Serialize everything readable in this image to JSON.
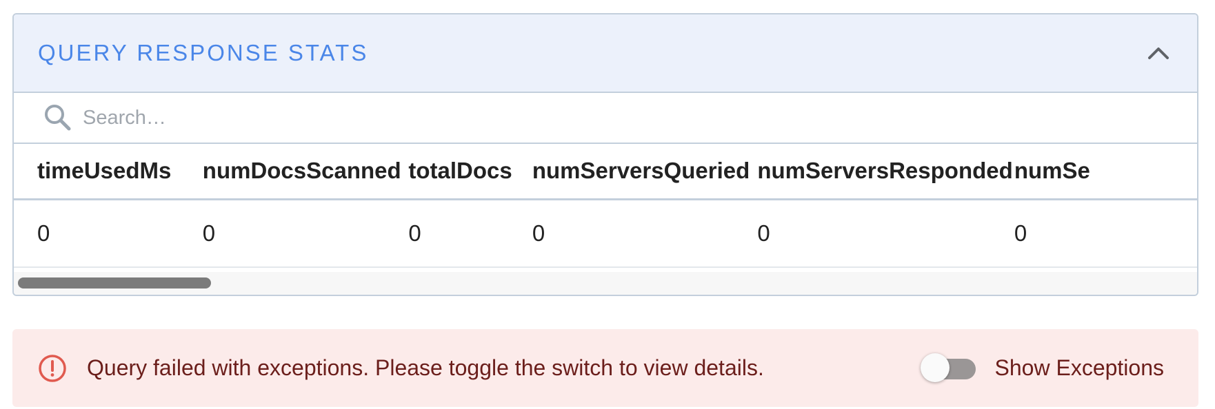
{
  "stats_panel": {
    "title": "QUERY RESPONSE STATS",
    "collapse_icon": "chevron-up-icon",
    "search": {
      "placeholder": "Search…",
      "value": "",
      "icon": "search-icon"
    },
    "table": {
      "columns": [
        "timeUsedMs",
        "numDocsScanned",
        "totalDocs",
        "numServersQueried",
        "numServersResponded",
        "numSe"
      ],
      "rows": [
        [
          "0",
          "0",
          "0",
          "0",
          "0",
          "0"
        ]
      ]
    }
  },
  "error_banner": {
    "icon": "error-circle-icon",
    "message": "Query failed with exceptions. Please toggle the switch to view details.",
    "toggle_label": "Show Exceptions",
    "toggle_on": false
  },
  "colors": {
    "accent": "#4a86e8",
    "header_bg": "#ecf1fb",
    "error_bg": "#fcebea",
    "error_text": "#6b1e1b",
    "error_icon": "#e05a4f"
  }
}
